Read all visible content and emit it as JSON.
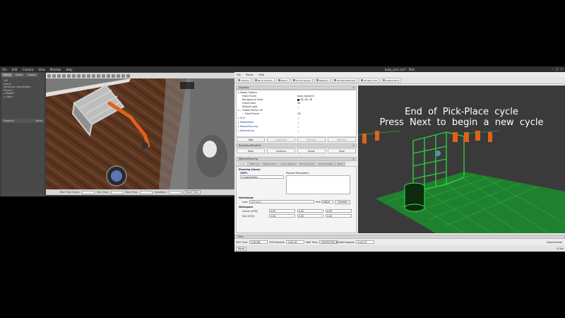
{
  "gazebo": {
    "menu": [
      "File",
      "Edit",
      "Camera",
      "View",
      "Window",
      "Help"
    ],
    "tabs": [
      "World",
      "Insert",
      "Layers"
    ],
    "tree": [
      "GUI",
      "Scene",
      "Spherical Coordinates",
      "Physics",
      "Models",
      "Lights"
    ],
    "property_header": {
      "property": "Property",
      "value": "Value"
    },
    "status": {
      "real_time_factor_label": "Real Time Factor:",
      "sim_time_label": "Sim Time:",
      "real_time_label": "Real Time:",
      "iterations_label": "Iterations:",
      "reset_time": "Reset Time"
    }
  },
  "rviz": {
    "title": "kuka_arm.rviz* - RViz",
    "menu": [
      "File",
      "Panels",
      "Help"
    ],
    "toolbar": [
      "Interact",
      "Move Camera",
      "Select",
      "Focus Camera",
      "Measure",
      "2D Pose Estimate",
      "2D Nav Goal",
      "Publish Point"
    ],
    "displays": {
      "header": "Displays",
      "rows": [
        {
          "label": "Global Options",
          "indent": 2,
          "value": ""
        },
        {
          "label": "Fixed Frame",
          "indent": 8,
          "value": "base_footprint"
        },
        {
          "label": "Background Color",
          "indent": 8,
          "value": "48; 48; 48",
          "swatch": true
        },
        {
          "label": "Frame Rate",
          "indent": 8,
          "value": "30"
        },
        {
          "label": "Default Light",
          "indent": 8,
          "check": "✓"
        },
        {
          "label": "Global Status: Ok",
          "indent": 2,
          "check": "✓"
        },
        {
          "label": "Fixed Frame",
          "indent": 8,
          "value": "OK"
        },
        {
          "label": "Grid",
          "indent": 2,
          "check": "✓",
          "blue": true
        },
        {
          "label": "RobotModel",
          "indent": 2,
          "check": "✓",
          "blue": true
        },
        {
          "label": "MotionPlanning",
          "indent": 2,
          "check": "✓",
          "blue": true
        },
        {
          "label": "MarkerArray",
          "indent": 2,
          "check": "✓",
          "blue": true
        }
      ],
      "buttons": [
        "Add",
        "Duplicate",
        "Remove",
        "Rename"
      ]
    },
    "rviz_tools": {
      "header": "RvizVisualToolsGui",
      "buttons": [
        "Next",
        "Continue",
        "Break",
        "Stop"
      ]
    },
    "motion_planning": {
      "header": "MotionPlanning",
      "tabs": [
        "Context",
        "Planning",
        "Manipulation",
        "Scene Objects",
        "Stored Scenes",
        "Stored States",
        "Status"
      ],
      "planning_library": "Planning Library",
      "ompl": "OMPL",
      "planner": "<unspecified>",
      "planner_params": "Planner Parameters",
      "warehouse": "Warehouse",
      "host_label": "Host:",
      "host": "127.0.0.1",
      "port_label": "Port:",
      "port": "33829",
      "connect": "Connect",
      "workspace": "Workspace",
      "center_label": "Center (XYZ):",
      "center": [
        "0.00",
        "0.00",
        "0.00"
      ],
      "size_label": "Size (XYZ):",
      "size": [
        "2.00",
        "2.00",
        "2.00"
      ]
    },
    "time": {
      "header": "Time",
      "ros_time_label": "ROS Time:",
      "ros_time": "2134.88",
      "ros_elapsed_label": "ROS Elapsed:",
      "ros_elapsed": "1140.90",
      "wall_time_label": "Wall Time:",
      "wall_time": "1529527931.80",
      "wall_elapsed_label": "Wall Elapsed:",
      "wall_elapsed": "1143.27",
      "mode": "Experimental"
    },
    "status": {
      "reset": "Reset",
      "fps": "31 fps"
    },
    "overlay": {
      "line1": "End  of  Pick-Place  cycle",
      "line2": "Press  Next  to  begin  a  new  cycle"
    }
  },
  "colors": {
    "grid_green": "#2ecc40",
    "overlay_text": "#ffffff",
    "robot_orange": "#e0601a",
    "selection_blue": "#6f92c4"
  }
}
